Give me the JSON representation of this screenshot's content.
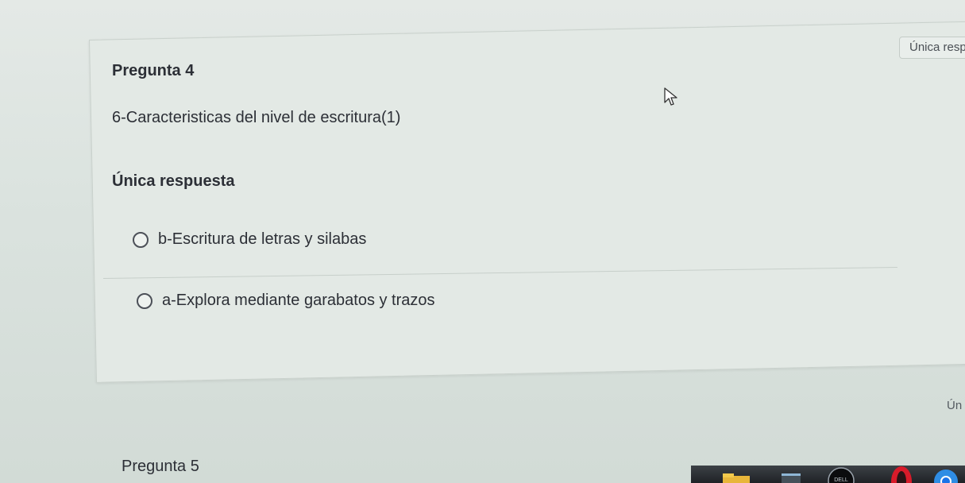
{
  "badge": {
    "label": "Única resp"
  },
  "question4": {
    "title": "Pregunta 4",
    "text": "6-Caracteristicas del nivel de escritura(1)",
    "answer_type": "Única respuesta",
    "options": [
      {
        "label": "b-Escritura de letras y silabas"
      },
      {
        "label": "a-Explora mediante garabatos y trazos"
      }
    ]
  },
  "next_badge_peek": "Ún",
  "question5": {
    "title": "Pregunta 5"
  },
  "taskbar": {
    "icons": [
      "folder-icon",
      "app-icon",
      "dell-icon",
      "opera-icon",
      "chrome-icon"
    ]
  },
  "colors": {
    "background": "#dbe3df",
    "card": "#e3e9e5",
    "text": "#2c2f36",
    "radio_border": "#4c5058"
  }
}
